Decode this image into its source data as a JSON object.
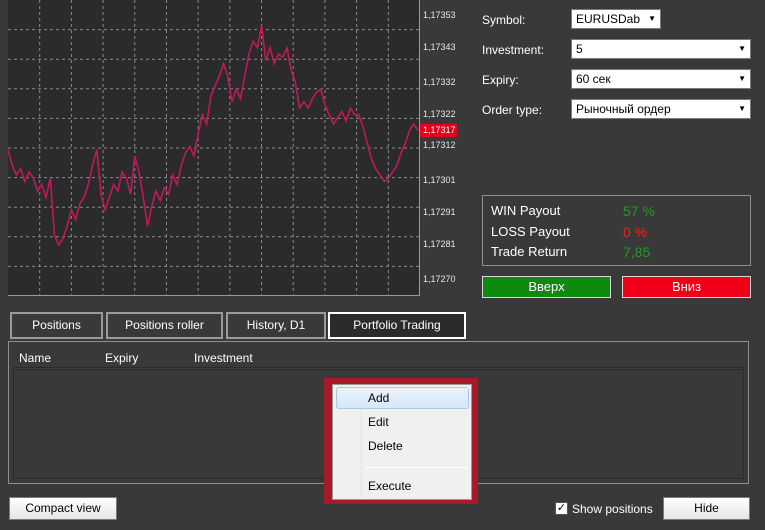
{
  "chart": {
    "price_labels": [
      "1,17353",
      "1,17343",
      "1,17332",
      "1,17322",
      "1,17312",
      "1,17301",
      "1,17291",
      "1,17281",
      "1,17270"
    ],
    "current_price": "1,17317",
    "line_color": "#c2185b",
    "grid_color": "#8a8a8a"
  },
  "chart_data": {
    "type": "line",
    "series": [
      {
        "values": [
          1.17311,
          1.17306,
          1.17303,
          1.17305,
          1.17301,
          1.17304,
          1.17302,
          1.17298,
          1.173,
          1.17296,
          1.17302,
          1.17284,
          1.17281,
          1.17283,
          1.17287,
          1.17292,
          1.17289,
          1.17294,
          1.17296,
          1.173,
          1.17306,
          1.17311,
          1.17297,
          1.17292,
          1.17296,
          1.173,
          1.17298,
          1.17304,
          1.17302,
          1.17297,
          1.17309,
          1.17304,
          1.17296,
          1.17287,
          1.17293,
          1.17298,
          1.17295,
          1.17299,
          1.17297,
          1.17303,
          1.173,
          1.17306,
          1.1731,
          1.17312,
          1.17309,
          1.17316,
          1.17322,
          1.17319,
          1.17328,
          1.17331,
          1.17334,
          1.17338,
          1.17334,
          1.17326,
          1.1733,
          1.17327,
          1.17334,
          1.17341,
          1.17345,
          1.17343,
          1.1735,
          1.17339,
          1.17343,
          1.17338,
          1.17341,
          1.1734,
          1.17343,
          1.17336,
          1.17332,
          1.17324,
          1.17326,
          1.17324,
          1.17327,
          1.17329,
          1.1733,
          1.17325,
          1.17322,
          1.17319,
          1.17321,
          1.17323,
          1.1732,
          1.17324,
          1.17322,
          1.17322,
          1.17318,
          1.17313,
          1.17308,
          1.17305,
          1.17303,
          1.17301,
          1.17302,
          1.17304,
          1.17306,
          1.1731,
          1.17313,
          1.17317,
          1.17319,
          1.17317
        ]
      }
    ],
    "ylim": [
      1.17265,
      1.17358
    ]
  },
  "form": {
    "symbol_label": "Symbol:",
    "symbol_value": "EURUSDab",
    "investment_label": "Investment:",
    "investment_value": "5",
    "expiry_label": "Expiry:",
    "expiry_value": "60 сек",
    "order_type_label": "Order type:",
    "order_type_value": "Рыночный ордер"
  },
  "payout": {
    "win_label": "WIN Payout",
    "win_value": "57 %",
    "loss_label": "LOSS Payout",
    "loss_value": "0 %",
    "return_label": "Trade Return",
    "return_value": "7,85",
    "win_color": "#1e9c1e",
    "loss_color": "#ff1a1a",
    "return_color": "#1e9c1e"
  },
  "buttons": {
    "up_label": "Вверх",
    "down_label": "Вниз",
    "up_color": "#0e8a0e",
    "down_color": "#f00018",
    "compact_label": "Compact view",
    "hide_label": "Hide",
    "show_positions_label": "Show positions",
    "show_positions_checked": "✓"
  },
  "tabs": [
    {
      "label": "Positions"
    },
    {
      "label": "Positions roller"
    },
    {
      "label": "History, D1"
    },
    {
      "label": "Portfolio Trading"
    }
  ],
  "list": {
    "columns": [
      "Name",
      "Expiry",
      "Investment"
    ]
  },
  "context_menu": {
    "items": [
      "Add",
      "Edit",
      "Delete",
      "Execute"
    ]
  }
}
